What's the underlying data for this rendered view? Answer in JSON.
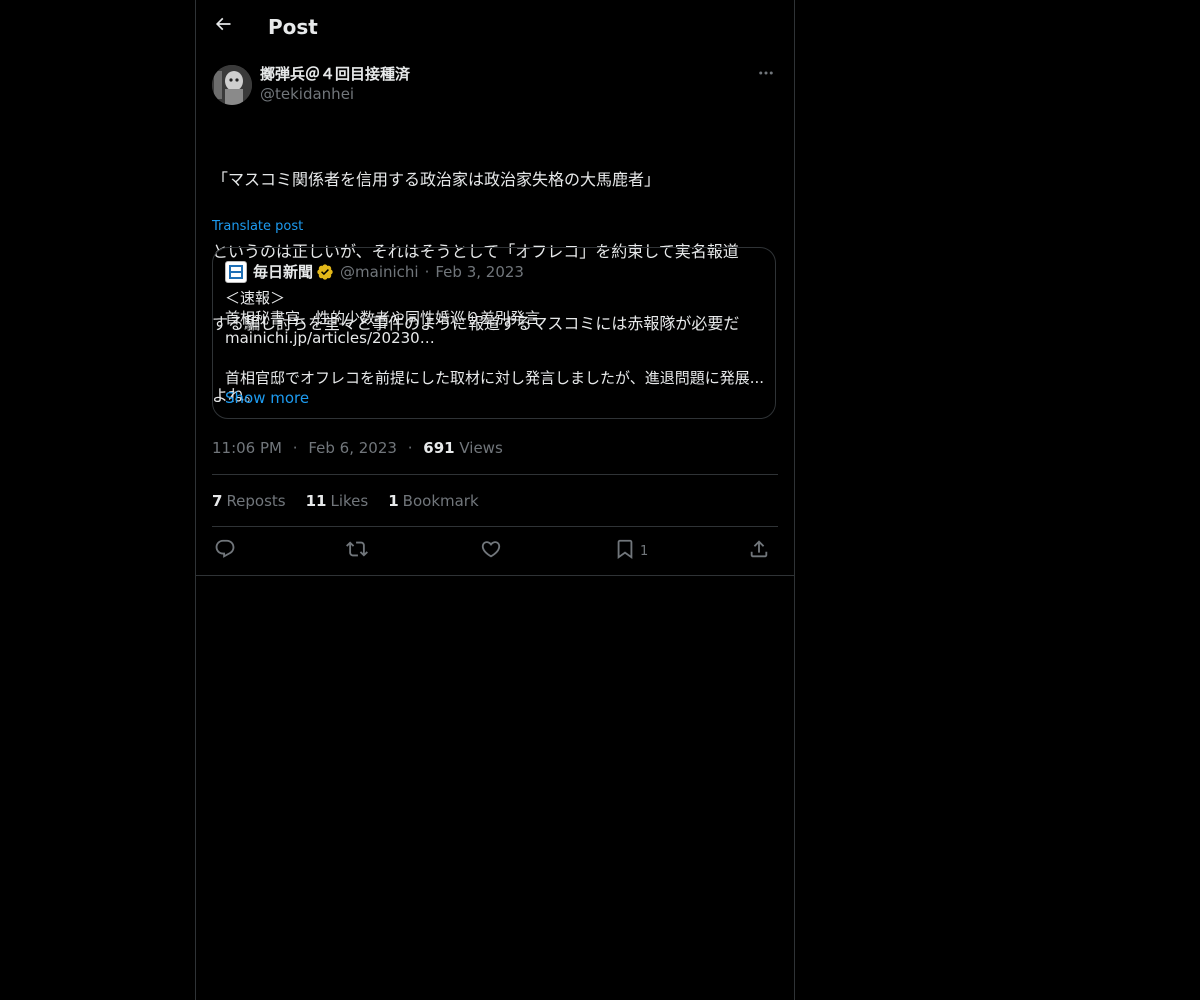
{
  "header": {
    "title": "Post"
  },
  "post": {
    "author": {
      "display_name": "擲弾兵＠４回目接種済",
      "handle": "@tekidanhei"
    },
    "text_lines": [
      "「マスコミ関係者を信用する政治家は政治家失格の大馬鹿者」",
      "というのは正しいが、それはそうとして「オフレコ」を約束して実名報道",
      "する騙し討ちを堂々と事件のように報道するマスコミには赤報隊が必要だ",
      "よね。"
    ],
    "translate_label": "Translate post",
    "quote": {
      "display_name": "毎日新聞",
      "handle": "@mainichi",
      "date": "Feb 3, 2023",
      "lines": [
        "＜速報＞",
        "首相秘書官、性的少数者や同性婚巡り差別発言",
        "mainichi.jp/articles/20230…",
        "",
        "首相官邸でオフレコを前提にした取材に対し発言しましたが、進退問題に発展..."
      ],
      "show_more": "Show more"
    },
    "meta": {
      "time": "11:06 PM",
      "date": "Feb 6, 2023",
      "separator": "·",
      "views_count": "691",
      "views_label": "Views"
    },
    "stats": {
      "reposts_count": "7",
      "reposts_label": "Reposts",
      "likes_count": "11",
      "likes_label": "Likes",
      "bookmarks_count": "1",
      "bookmarks_label": "Bookmark"
    },
    "actions": {
      "bookmark_count": "1"
    }
  },
  "colors": {
    "background": "#000000",
    "text": "#e7e9ea",
    "muted": "#71767b",
    "accent": "#1d9bf0",
    "border": "#2f3336",
    "verified_gold": "#e2b719"
  },
  "icons": {
    "back": "arrow-left-icon",
    "more": "more-horizontal-icon",
    "verified": "verified-badge-icon",
    "reply": "reply-icon",
    "repost": "repost-icon",
    "like": "heart-icon",
    "bookmark": "bookmark-icon",
    "share": "share-icon"
  }
}
